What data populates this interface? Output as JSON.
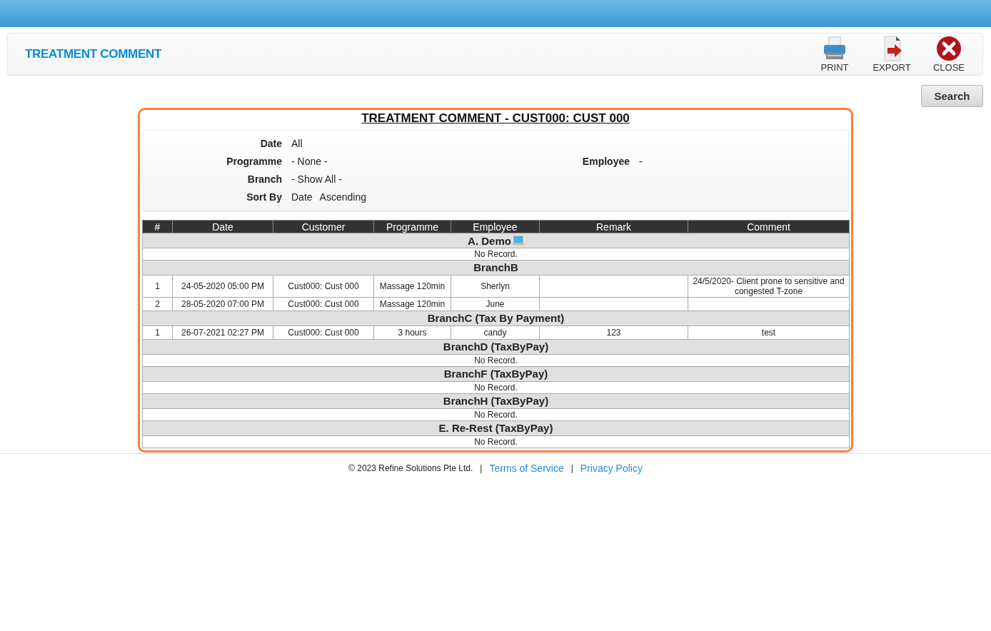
{
  "header": {
    "title": "TREATMENT COMMENT",
    "actions": [
      {
        "kind": "print",
        "label": "PRINT"
      },
      {
        "kind": "export",
        "label": "EXPORT"
      },
      {
        "kind": "close",
        "label": "CLOSE"
      }
    ]
  },
  "search_button": "Search",
  "report": {
    "title": "TREATMENT COMMENT - CUST000: CUST 000",
    "filter_rows": [
      [
        {
          "label": "Date",
          "values": [
            "All"
          ]
        }
      ],
      [
        {
          "label": "Programme",
          "values": [
            "- None -"
          ]
        },
        {
          "label": "Employee",
          "values": [
            "-"
          ]
        }
      ],
      [
        {
          "label": "Branch",
          "values": [
            "- Show All -"
          ]
        }
      ],
      [
        {
          "label": "Sort By",
          "values": [
            "Date",
            "Ascending"
          ]
        }
      ]
    ],
    "columns": [
      "#",
      "Date",
      "Customer",
      "Programme",
      "Employee",
      "Remark",
      "Comment"
    ],
    "groups": [
      {
        "name": "A. Demo",
        "device_icon": true,
        "empty_text": "No Record."
      },
      {
        "name": "BranchB",
        "device_icon": false,
        "rows": [
          [
            "1",
            "24-05-2020 05:00 PM",
            "Cust000: Cust 000",
            "Massage 120min",
            "Sherlyn",
            "",
            "24/5/2020- Client prone to sensitive and congested T-zone"
          ],
          [
            "2",
            "28-05-2020 07:00 PM",
            "Cust000: Cust 000",
            "Massage 120min",
            "June",
            "",
            ""
          ]
        ]
      },
      {
        "name": "BranchC (Tax By Payment)",
        "device_icon": false,
        "rows": [
          [
            "1",
            "26-07-2021 02:27 PM",
            "Cust000: Cust 000",
            "3 hours",
            "candy",
            "123",
            "test"
          ]
        ]
      },
      {
        "name": "BranchD (TaxByPay)",
        "device_icon": false,
        "empty_text": "No Record."
      },
      {
        "name": "BranchF (TaxByPay)",
        "device_icon": false,
        "empty_text": "No Record."
      },
      {
        "name": "BranchH (TaxByPay)",
        "device_icon": false,
        "empty_text": "No Record."
      },
      {
        "name": "E. Re-Rest (TaxByPay)",
        "device_icon": false,
        "empty_text": "No Record."
      }
    ]
  },
  "footer": {
    "copyright": "© 2023 Refine Solutions Pte Ltd.",
    "links": [
      "Terms of Service",
      "Privacy Policy"
    ],
    "separator": "|"
  }
}
